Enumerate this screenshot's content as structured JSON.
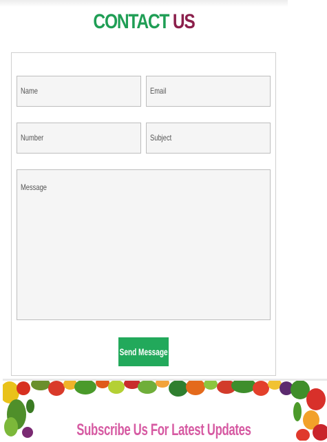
{
  "header": {
    "title_part1": "CONTACT",
    "title_part2": "US"
  },
  "form": {
    "name_placeholder": "Name",
    "email_placeholder": "Email",
    "number_placeholder": "Number",
    "subject_placeholder": "Subject",
    "message_placeholder": "Message",
    "send_label": "Send Message"
  },
  "subscribe": {
    "heading": "Subscribe Us For Latest Updates"
  },
  "colors": {
    "accent_green": "#22a95b",
    "title_green": "#1f9e55",
    "title_maroon": "#8b1f4b",
    "subscribe_pink": "#d65aa2"
  }
}
